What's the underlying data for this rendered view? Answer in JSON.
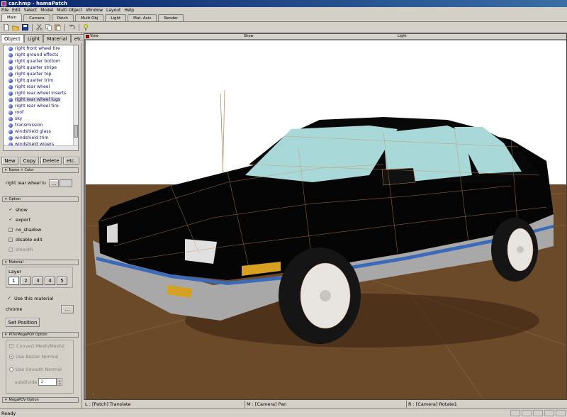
{
  "window": {
    "title": "car.hmp - hamaPatch"
  },
  "menu": [
    "File",
    "Edit",
    "Select",
    "Model",
    "Multi Object",
    "Window",
    "Layout",
    "Help"
  ],
  "tabs": [
    {
      "label": "Main",
      "active": true
    },
    {
      "label": "Camera",
      "active": false
    },
    {
      "label": "Patch",
      "active": false
    },
    {
      "label": "Multi Obj",
      "active": false
    },
    {
      "label": "Light",
      "active": false
    },
    {
      "label": "Mat. Axis",
      "active": false
    },
    {
      "label": "Render",
      "active": false
    }
  ],
  "toolbar": {
    "icons": [
      "new-file-icon",
      "open-folder-icon",
      "save-icon",
      "cut-icon",
      "copy-icon",
      "paste-icon",
      "undo-icon",
      "help-pin-icon"
    ]
  },
  "panel": {
    "tabs": [
      {
        "label": "Object",
        "active": true
      },
      {
        "label": "Light",
        "active": false
      },
      {
        "label": "Material",
        "active": false
      },
      {
        "label": "etc.",
        "active": false
      }
    ],
    "objects": [
      "right front wheel tire",
      "right ground effects",
      "right quarter bottom",
      "right quarter stripe",
      "right quarter top",
      "right quarter trim",
      "right rear wheel",
      "right rear wheel inserts",
      "right rear wheel lugs",
      "right rear wheel tire",
      "roof",
      "sky",
      "transmission",
      "windshield glass",
      "windshield trim",
      "windshield wipers"
    ],
    "selected_index": 8,
    "buttons": {
      "new": "New",
      "copy": "Copy",
      "delete": "Delete",
      "etc": "etc."
    },
    "name_section": {
      "header": "Name + Color",
      "name_value": "right rear wheel lu",
      "browse_label": "..."
    },
    "option_section": {
      "header": "Option",
      "show": {
        "label": "show",
        "checked": true
      },
      "export": {
        "label": "export",
        "checked": true
      },
      "no_shadow": {
        "label": "no_shadow",
        "checked": false
      },
      "disable_edit": {
        "label": "disable edit",
        "checked": false
      },
      "smooth": {
        "label": "smooth",
        "checked": false
      }
    },
    "material_section": {
      "header": "Material",
      "layer_label": "Layer",
      "layers": [
        "1",
        "2",
        "3",
        "4",
        "5"
      ],
      "active_layer": "1",
      "use_material": {
        "label": "Use this material",
        "checked": true
      },
      "material_value": "chrome",
      "browse_label": "...",
      "set_position": "Set Position"
    },
    "pov_section": {
      "header": "POV/MegaPOV Option",
      "convert": {
        "label": "Convert Mesh/Mesh2",
        "checked": false
      },
      "bezier": {
        "label": "Use Bezier Normal",
        "selected": true
      },
      "smooth": {
        "label": "Use Smooth Normal",
        "selected": false
      },
      "subdivide_label": "subdivide",
      "subdivide_value": "2"
    },
    "megapov_header": "MegaPOV Option"
  },
  "viewport": {
    "header": {
      "view": "View",
      "show": "Show",
      "light": "Light"
    },
    "colors": {
      "sky": "#ffffff",
      "ground": "#6b4a2a",
      "body": "#050505",
      "rocker": "#a8a8a8",
      "stripe": "#3a6ab8",
      "glass": "#a8d8d8",
      "wire": "#c89060"
    }
  },
  "status": {
    "left": "L : [Patch] Translate",
    "middle": "M : [Camera] Pan",
    "right": "R : [Camera] Rotate1",
    "bottom": "Ready"
  }
}
